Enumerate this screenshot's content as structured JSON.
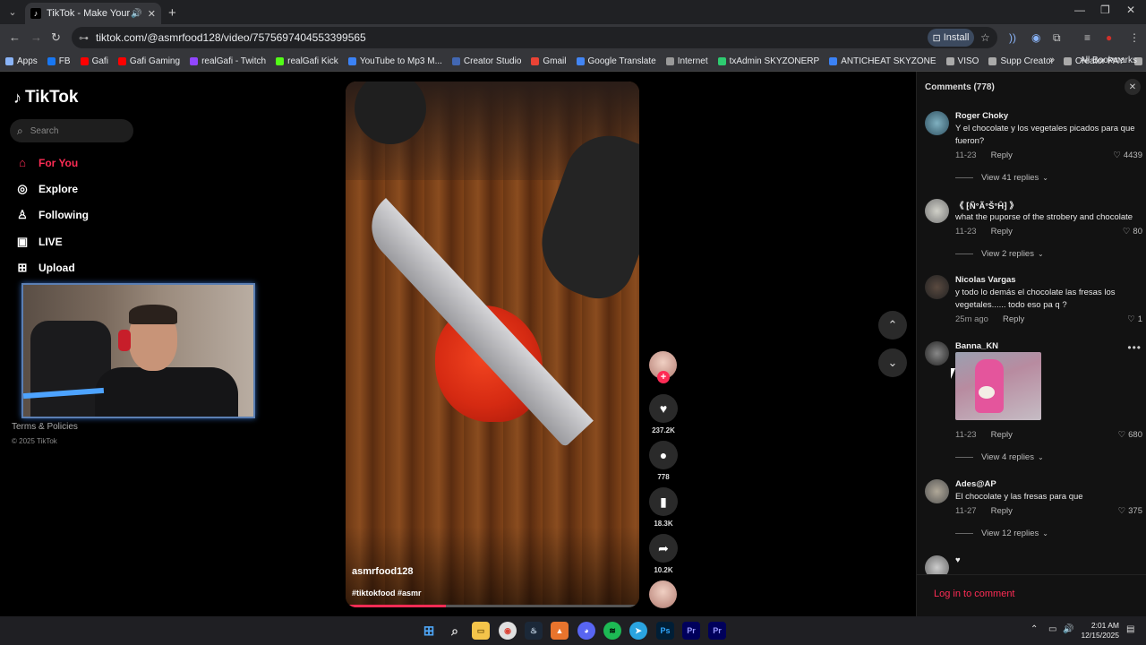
{
  "browser": {
    "tab_title": "TikTok - Make Your Day",
    "url": "tiktok.com/@asmrfood128/video/7575697404553399565",
    "install_label": "Install",
    "bookmarks": [
      {
        "label": "Apps",
        "color": "#8ab4f8"
      },
      {
        "label": "FB",
        "color": "#1877f2"
      },
      {
        "label": "Gafi",
        "color": "#ff0000"
      },
      {
        "label": "Gafi Gaming",
        "color": "#ff0000"
      },
      {
        "label": "realGafi - Twitch",
        "color": "#9146ff"
      },
      {
        "label": "realGafi Kick",
        "color": "#53fc18"
      },
      {
        "label": "YouTube to Mp3 M...",
        "color": "#3b82f6"
      },
      {
        "label": "Creator Studio",
        "color": "#4267b2"
      },
      {
        "label": "Gmail",
        "color": "#ea4335"
      },
      {
        "label": "Google Translate",
        "color": "#4285f4"
      },
      {
        "label": "Internet",
        "color": "#999999"
      },
      {
        "label": "txAdmin SKYZONERP",
        "color": "#2ecc71"
      },
      {
        "label": "ANTICHEAT SKYZONE",
        "color": "#3b82f6"
      },
      {
        "label": "VISO",
        "color": "#aaaaaa"
      },
      {
        "label": "Supp Creator",
        "color": "#aaaaaa"
      },
      {
        "label": "Creator PAY",
        "color": "#aaaaaa"
      },
      {
        "label": "ES",
        "color": "#aaaaaa"
      }
    ],
    "all_bookmarks": "All Bookmarks"
  },
  "sidebar": {
    "logo": "TikTok",
    "search_placeholder": "Search",
    "nav": [
      {
        "label": "For You",
        "icon": "home-icon"
      },
      {
        "label": "Explore",
        "icon": "compass-icon"
      },
      {
        "label": "Following",
        "icon": "user-icon"
      },
      {
        "label": "LIVE",
        "icon": "live-icon"
      },
      {
        "label": "Upload",
        "icon": "upload-icon"
      }
    ],
    "terms": "Terms & Policies",
    "copyright": "© 2025 TikTok"
  },
  "video": {
    "author": "asmrfood128",
    "tags": "#tiktokfood #asmr",
    "progress": 0.34
  },
  "actions": {
    "likes": "237.2K",
    "comments": "778",
    "saves": "18.3K",
    "shares": "10.2K"
  },
  "comments": {
    "header": "Comments (778)",
    "login": "Log in to comment",
    "items": [
      {
        "user": "Roger Choky",
        "text": "Y el chocolate y los vegetales picados para que fueron?",
        "date": "11-23",
        "reply": "Reply",
        "likes": "4439",
        "view": "View 41 replies"
      },
      {
        "user": "《 ⁅Ñ°Ã°Š°Ĥ⁆ 》",
        "text": "what the puporse of the strobery and chocolate",
        "date": "11-23",
        "reply": "Reply",
        "likes": "80",
        "view": "View 2 replies"
      },
      {
        "user": "Nicolas Vargas",
        "text": "y todo lo demás el chocolate las fresas los vegetales...... todo eso pa q ?",
        "date": "25m ago",
        "reply": "Reply",
        "likes": "1"
      },
      {
        "user": "Banna_KN",
        "date": "11-23",
        "reply": "Reply",
        "likes": "680",
        "view": "View 4 replies"
      },
      {
        "user": "Ades@AP",
        "text": "El chocolate y las fresas para que",
        "date": "11-27",
        "reply": "Reply",
        "likes": "375",
        "view": "View 12 replies"
      },
      {
        "user": "♥"
      }
    ]
  },
  "taskbar": {
    "time": "2:01 AM",
    "date": "12/15/2025"
  }
}
